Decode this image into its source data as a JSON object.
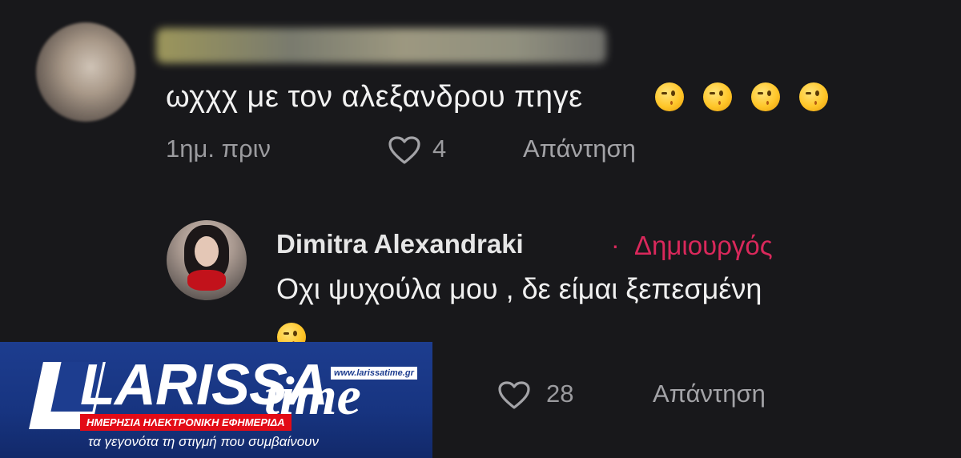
{
  "comments": [
    {
      "text": "ωχχχ με τον αλεξανδρου πηγε",
      "emojis": [
        "winking-face-emoji",
        "winking-face-emoji",
        "winking-face-emoji",
        "smirking-face-emoji"
      ],
      "time": "1ημ. πριν",
      "likes": "4",
      "reply_label": "Απάντηση"
    }
  ],
  "reply": {
    "author": "Dimitra Alexandraki",
    "separator": "·",
    "badge": "Δημιουργός",
    "text": "Οχι ψυχούλα μου , δε είμαι ξεπεσμένη",
    "emoji": "winking-face-emoji",
    "likes": "28",
    "reply_label": "Απάντηση"
  },
  "watermark": {
    "brand": "LARISSA",
    "brand_suffix": "time",
    "url": "www.larissatime.gr",
    "tagline": "ΗΜΕΡΗΣΙΑ ΗΛΕΚΤΡΟΝΙΚΗ ΕΦΗΜΕΡΙΔΑ",
    "slogan": "τα γεγονότα τη στιγμή που συμβαίνουν"
  },
  "colors": {
    "background": "#18181b",
    "creator_accent": "#d9285b",
    "muted_text": "#9b9b9f",
    "banner_blue": "#1d3d8f",
    "banner_red": "#e30b16"
  }
}
